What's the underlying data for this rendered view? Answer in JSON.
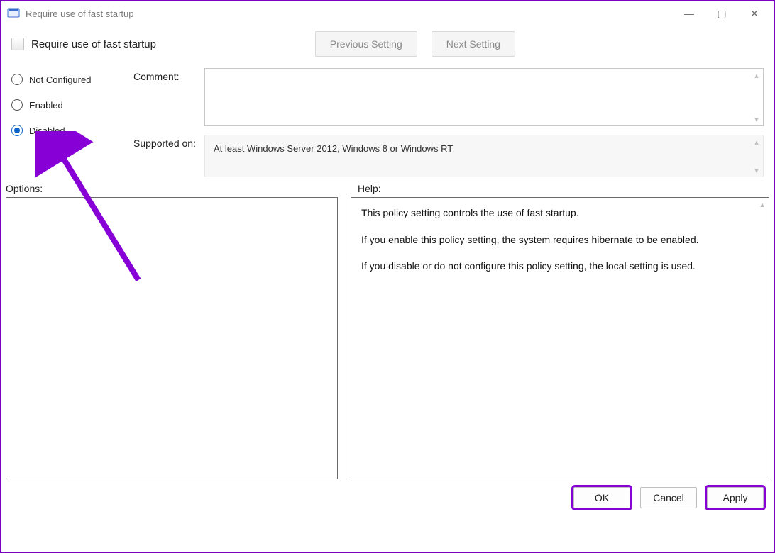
{
  "window": {
    "title": "Require use of fast startup"
  },
  "subheader": {
    "title": "Require use of fast startup"
  },
  "nav": {
    "prev": "Previous Setting",
    "next": "Next Setting"
  },
  "radios": {
    "not_configured": "Not Configured",
    "enabled": "Enabled",
    "disabled": "Disabled",
    "selected": "disabled"
  },
  "fields": {
    "comment_label": "Comment:",
    "comment_value": "",
    "supported_label": "Supported on:",
    "supported_value": "At least Windows Server 2012, Windows 8 or Windows RT"
  },
  "labels": {
    "options": "Options:",
    "help": "Help:"
  },
  "help": {
    "p1": "This policy setting controls the use of fast startup.",
    "p2": "If you enable this policy setting, the system requires hibernate to be enabled.",
    "p3": "If you disable or do not configure this policy setting, the local setting is used."
  },
  "buttons": {
    "ok": "OK",
    "cancel": "Cancel",
    "apply": "Apply"
  }
}
